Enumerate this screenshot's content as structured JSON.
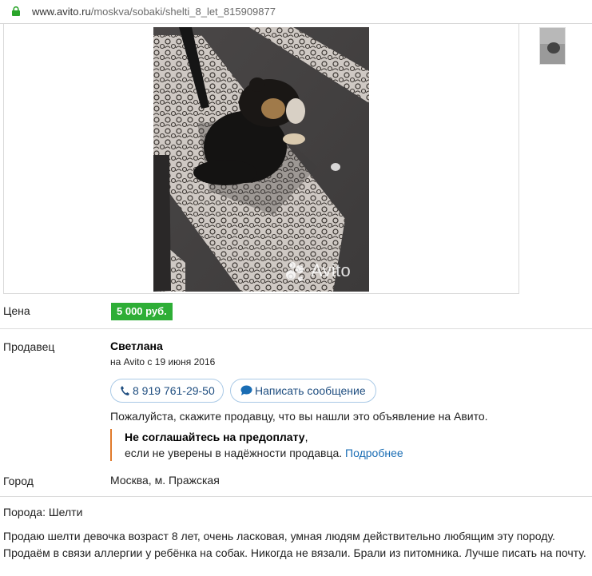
{
  "browser": {
    "url_host": "www.avito.ru",
    "url_path": "/moskva/sobaki/shelti_8_let_815909877"
  },
  "gallery": {
    "watermark": "Avito",
    "thumb_count": 1
  },
  "price": {
    "label": "Цена",
    "value": "5 000 руб.",
    "color": "#2eae36"
  },
  "seller": {
    "label": "Продавец",
    "name": "Светлана",
    "since": "на Avito с 19 июня 2016",
    "phone_button": "8 919 761-29-50",
    "message_button": "Написать сообщение",
    "hint": "Пожалуйста, скажите продавцу, что вы нашли это объявление на Авито.",
    "warning_title": "Не соглашайтесь на предоплату",
    "warning_comma": ",",
    "warning_text": "если не уверены в надёжности продавца.",
    "warning_link": "Подробнее"
  },
  "city": {
    "label": "Город",
    "value": "Москва, м. Пражская"
  },
  "details": {
    "breed": "Порода: Шелти",
    "description": "Продаю шелти девочка возраст 8 лет, очень ласковая, умная людям действительно любящим эту породу. Продаём в связи аллергии у ребёнка на собак. Никогда не вязали. Брали из питомника. Лучше писать на почту."
  }
}
